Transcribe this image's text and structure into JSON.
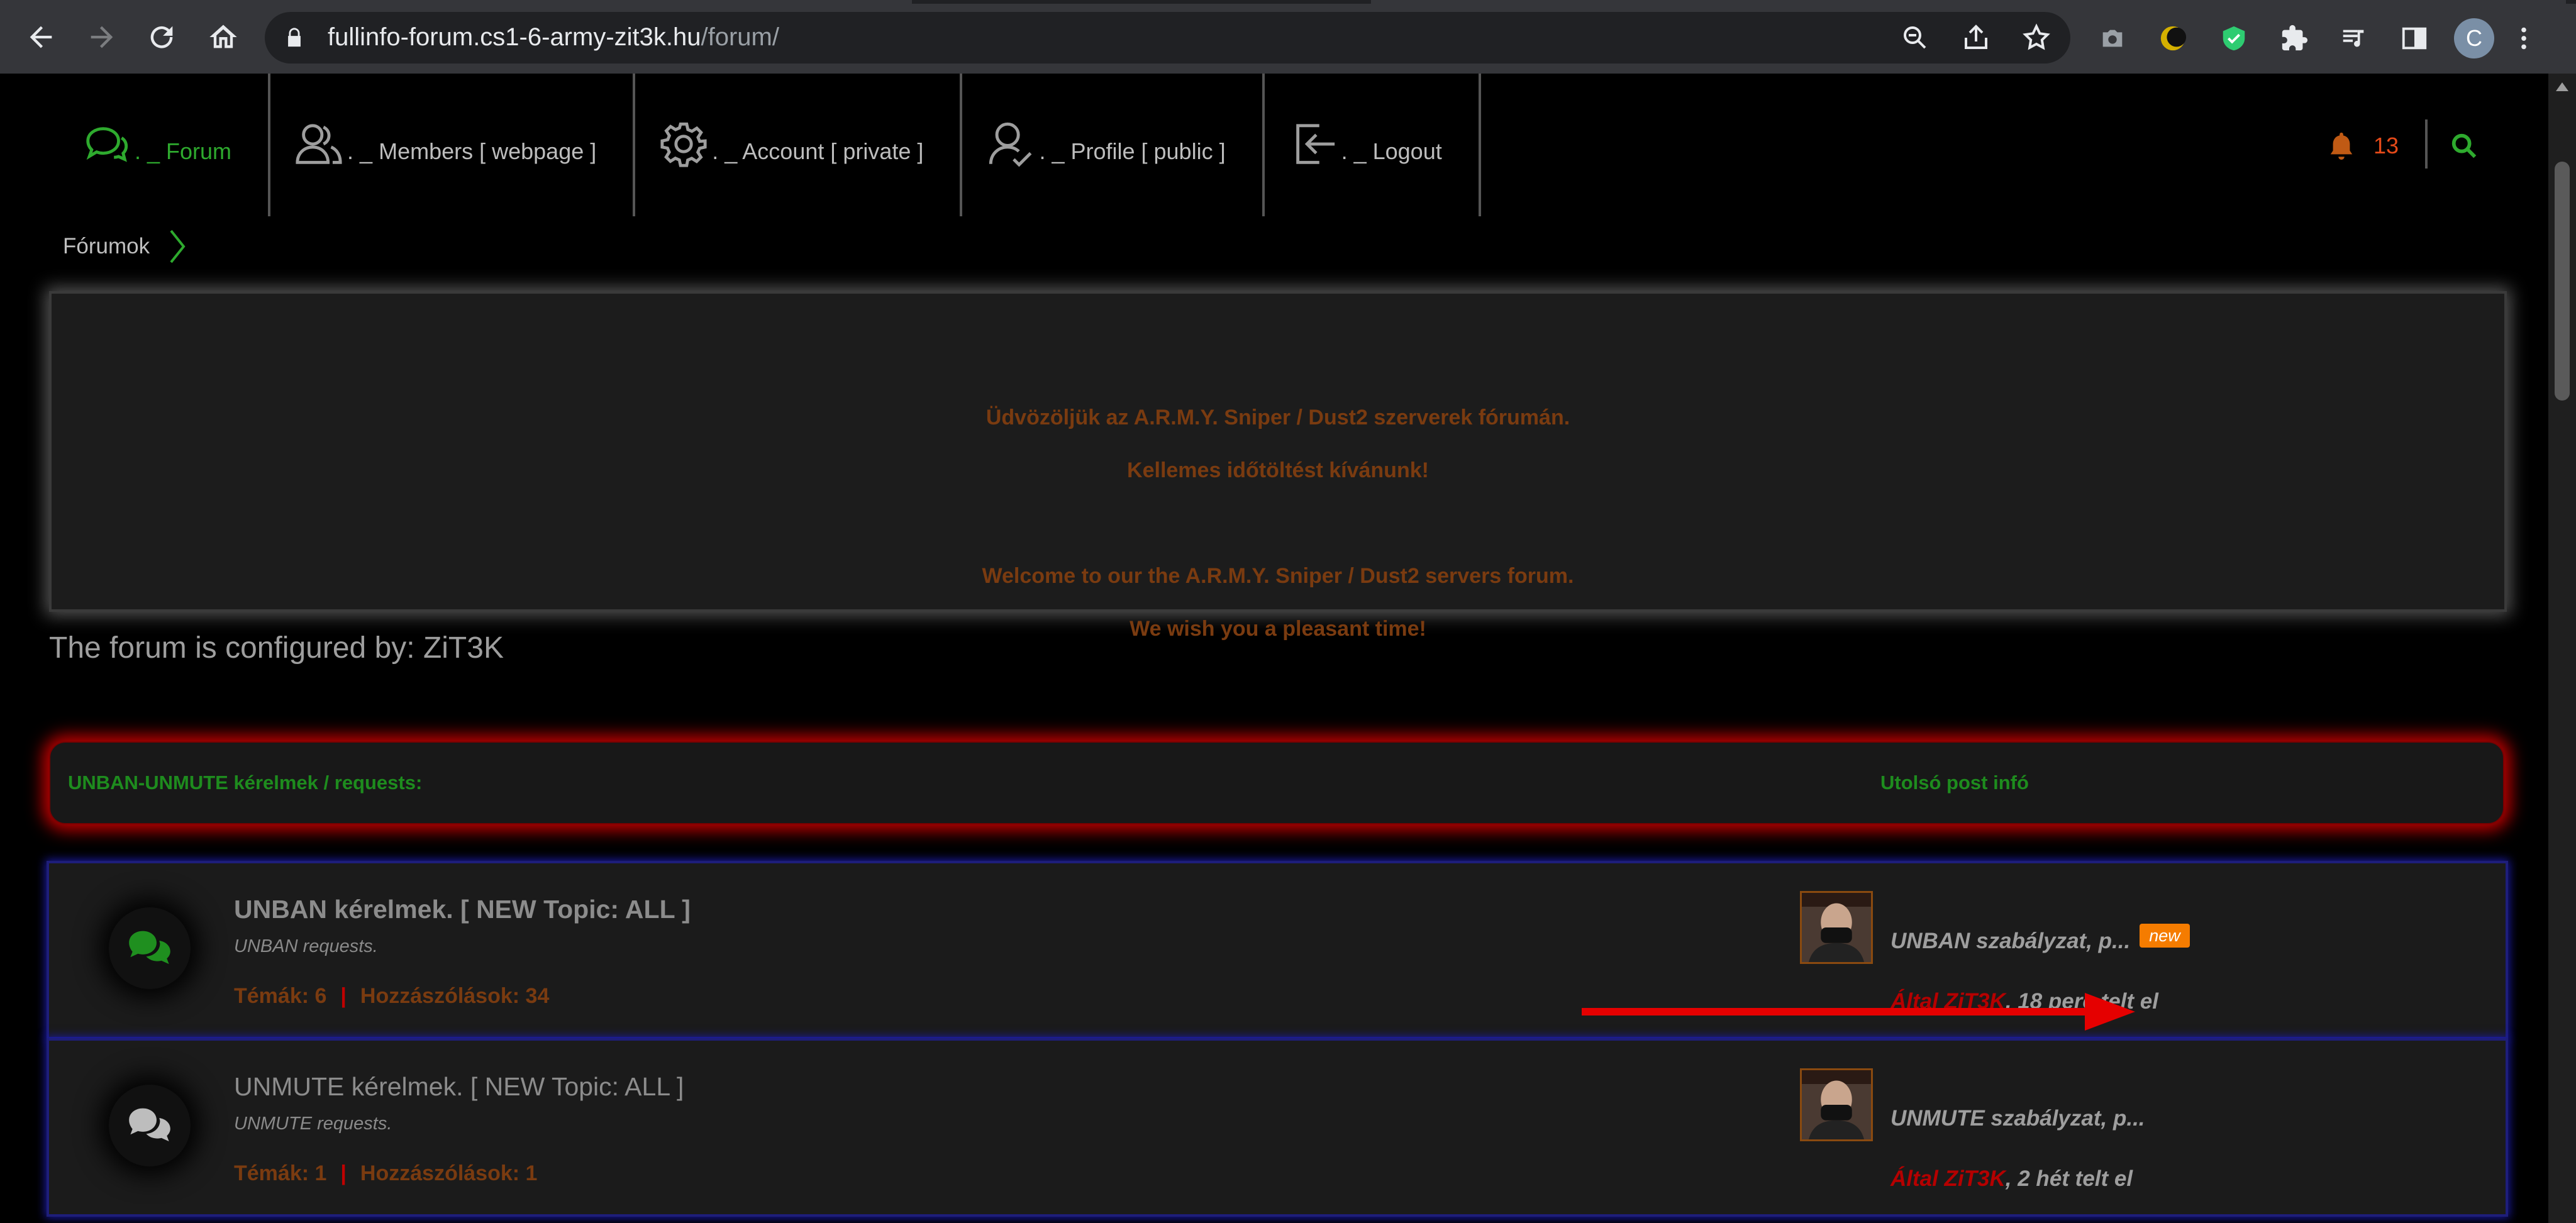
{
  "browser": {
    "url_host": "fullinfo-forum.cs1-6-army-zit3k.hu",
    "url_path": "/forum/",
    "profile_initial": "C"
  },
  "nav": {
    "items": [
      {
        "label": ". _ Forum",
        "icon": "chat-bubbles-icon"
      },
      {
        "label": ". _ Members [ webpage ]",
        "icon": "users-icon"
      },
      {
        "label": ". _ Account [ private ]",
        "icon": "gear-icon"
      },
      {
        "label": ". _ Profile [ public ]",
        "icon": "user-check-icon"
      },
      {
        "label": ". _ Logout",
        "icon": "logout-icon"
      }
    ],
    "notification_count": "13"
  },
  "breadcrumb": {
    "label": "Fórumok"
  },
  "welcome": {
    "line1": "Üdvözöljük az A.R.M.Y. Sniper / Dust2 szerverek fórumán.",
    "line2": "Kellemes időtöltést kívánunk!",
    "line3": "Welcome to our the A.R.M.Y. Sniper / Dust2 servers forum.",
    "line4": "We wish you a pleasant time!"
  },
  "configured_by": "The forum is configured by: ZiT3K",
  "category": {
    "title": "UNBAN-UNMUTE kérelmek / requests:",
    "last_post_header": "Utolsó post infó"
  },
  "forums": [
    {
      "title": "UNBAN kérelmek. [ NEW Topic: ALL ]",
      "description": "UNBAN requests.",
      "topics": "Témák: 6",
      "posts": "Hozzászólások: 34",
      "last_post_title": "UNBAN szabályzat, p...",
      "new_badge": "new",
      "last_post_author": "Által ZiT3K",
      "last_post_time": ", 18 perc telt el",
      "icon_color": "#1f8f1f"
    },
    {
      "title": "UNMUTE kérelmek. [ NEW Topic: ALL ]",
      "description": "UNMUTE requests.",
      "topics": "Témák: 1",
      "posts": "Hozzászólások: 1",
      "last_post_title": "UNMUTE szabályzat, p...",
      "last_post_author": "Által ZiT3K",
      "last_post_time": ", 2 hét telt el",
      "icon_color": "#bdbdbd"
    }
  ],
  "colors": {
    "accent_green": "#2eaa2e",
    "heading_brown": "#7a3b10",
    "author_red": "#b50000",
    "badge_orange": "#f57c00",
    "header_glow_red": "#c00000",
    "row_border_blue": "#1e1e7a"
  }
}
